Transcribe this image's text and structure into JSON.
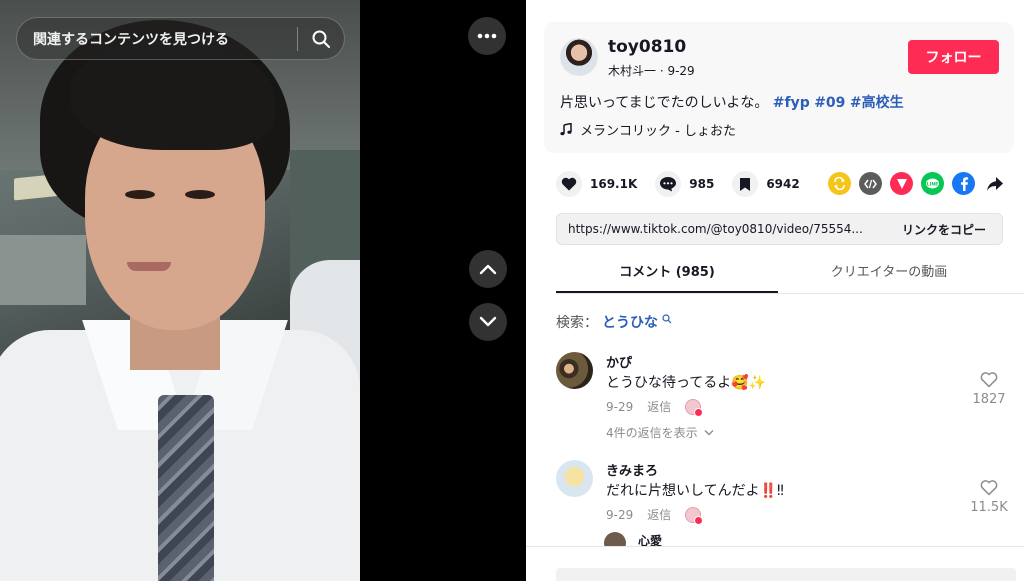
{
  "search": {
    "placeholder_text": "関連するコンテンツを見つける"
  },
  "post": {
    "username": "toy0810",
    "nickname_date": "木村斗一 · 9-29",
    "follow_label": "フォロー",
    "caption_text": "片思いってまじでたのしいよな。",
    "hashtags": [
      "#fyp",
      "#09",
      "#高校生"
    ],
    "music": "メランコリック - しょおた"
  },
  "actions": {
    "likes": "169.1K",
    "comments": "985",
    "saves": "6942"
  },
  "share": {
    "icons": [
      "repost-icon",
      "embed-icon",
      "send-icon",
      "line-icon",
      "facebook-icon",
      "share-arrow-icon"
    ],
    "colors": {
      "repost": "#f5c518",
      "embed": "#5c5c5c",
      "send": "#fe2c55",
      "line": "#06c755",
      "facebook": "#1877f2"
    }
  },
  "link": {
    "url": "https://www.tiktok.com/@toy0810/video/75554...",
    "copy_label": "リンクをコピー"
  },
  "tabs": [
    {
      "label": "コメント (985)",
      "active": true
    },
    {
      "label": "クリエイターの動画",
      "active": false
    }
  ],
  "comment_search": {
    "prefix": "検索：",
    "query": "とうひな"
  },
  "comments": [
    {
      "user": "かぴ",
      "text": "とうひな待ってるよ🥰✨",
      "date": "9-29",
      "reply_label": "返信",
      "likes": "1827",
      "view_replies": "4件の返信を表示"
    },
    {
      "user": "きみまろ",
      "text": "だれに片想いしてんだよ‼️‼",
      "date": "9-29",
      "reply_label": "返信",
      "likes": "11.5K"
    },
    {
      "user": "心愛"
    }
  ],
  "colors": {
    "accent": "#fe2c55",
    "hashtag": "#2b5db9"
  }
}
